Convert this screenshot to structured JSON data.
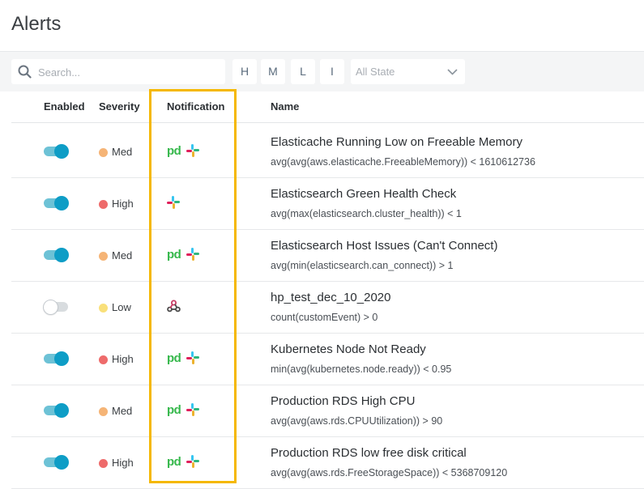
{
  "page": {
    "title": "Alerts"
  },
  "filters": {
    "search_placeholder": "Search...",
    "severity_buttons": [
      "H",
      "M",
      "L",
      "I"
    ],
    "state_select": "All State"
  },
  "columns": {
    "enabled": "Enabled",
    "severity": "Severity",
    "notification": "Notification",
    "name": "Name"
  },
  "severity_colors": {
    "High": "#ee6b6b",
    "Med": "#f5b476",
    "Low": "#f9e07a"
  },
  "accent_color": "#0e9dc6",
  "highlight_color": "#f5b800",
  "alerts": [
    {
      "enabled": true,
      "severity": "Med",
      "notifications": [
        "pagerduty-icon",
        "slack-icon"
      ],
      "name": "Elasticache Running Low on Freeable Memory",
      "query": "avg(avg(aws.elasticache.FreeableMemory)) < 1610612736"
    },
    {
      "enabled": true,
      "severity": "High",
      "notifications": [
        "slack-icon"
      ],
      "name": "Elasticsearch Green Health Check",
      "query": "avg(max(elasticsearch.cluster_health)) < 1"
    },
    {
      "enabled": true,
      "severity": "Med",
      "notifications": [
        "pagerduty-icon",
        "slack-icon"
      ],
      "name": "Elasticsearch Host Issues (Can't Connect)",
      "query": "avg(min(elasticsearch.can_connect)) > 1"
    },
    {
      "enabled": false,
      "severity": "Low",
      "notifications": [
        "webhook-icon"
      ],
      "name": "hp_test_dec_10_2020",
      "query": "count(customEvent) > 0"
    },
    {
      "enabled": true,
      "severity": "High",
      "notifications": [
        "pagerduty-icon",
        "slack-icon"
      ],
      "name": "Kubernetes Node Not Ready",
      "query": "min(avg(kubernetes.node.ready)) < 0.95"
    },
    {
      "enabled": true,
      "severity": "Med",
      "notifications": [
        "pagerduty-icon",
        "slack-icon"
      ],
      "name": "Production RDS High CPU",
      "query": "avg(avg(aws.rds.CPUUtilization)) > 90"
    },
    {
      "enabled": true,
      "severity": "High",
      "notifications": [
        "pagerduty-icon",
        "slack-icon"
      ],
      "name": "Production RDS low free disk critical",
      "query": "avg(avg(aws.rds.FreeStorageSpace)) < 5368709120"
    }
  ]
}
